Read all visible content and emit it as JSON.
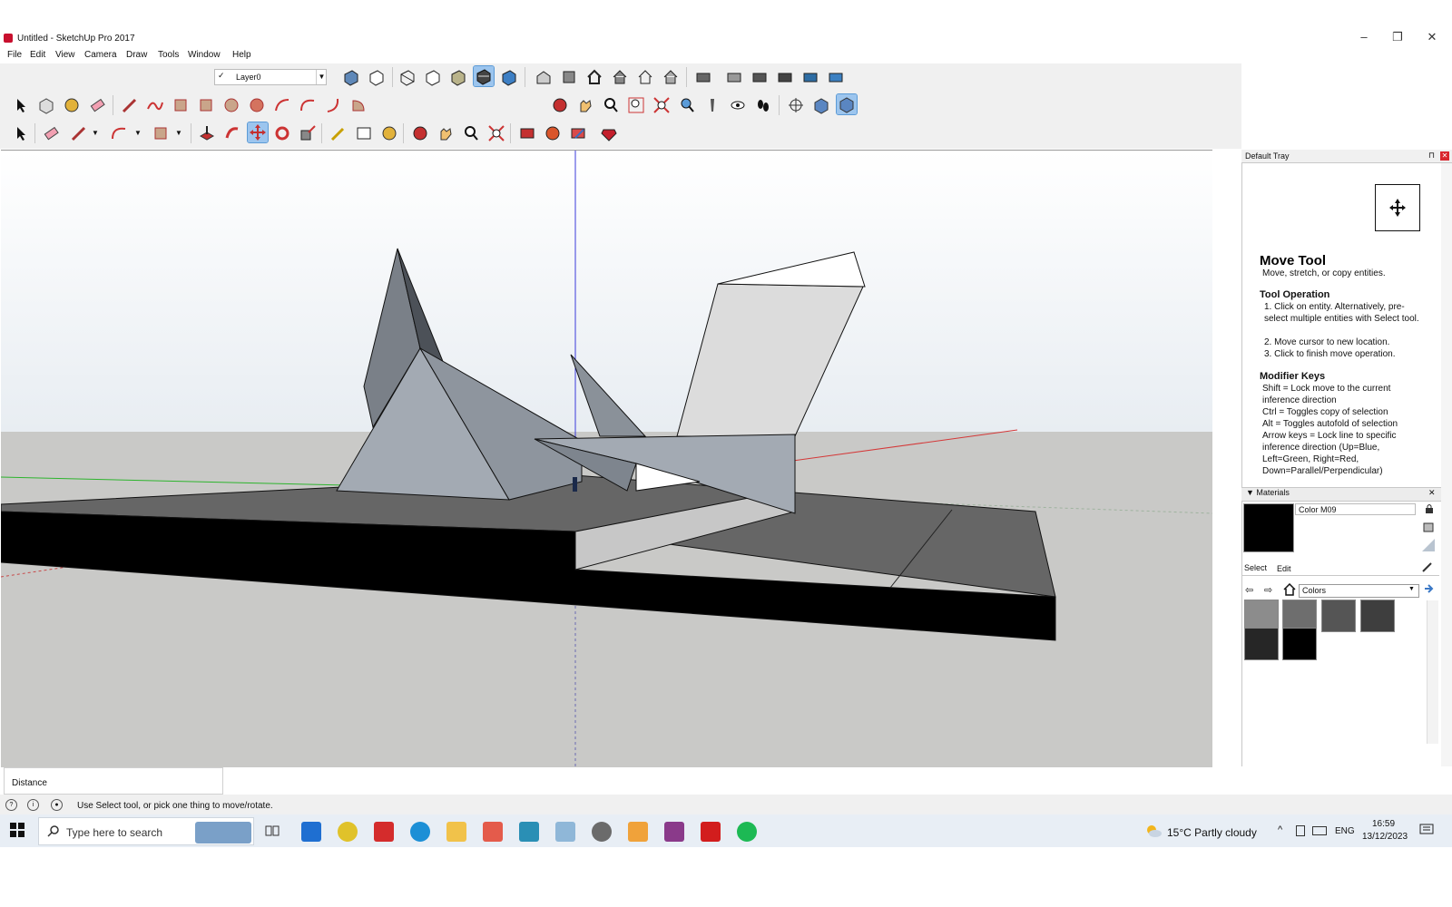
{
  "window": {
    "title": "Untitled - SketchUp Pro 2017",
    "minimize": "–",
    "restore": "❐",
    "close": "✕"
  },
  "menu": [
    "File",
    "Edit",
    "View",
    "Camera",
    "Draw",
    "Tools",
    "Window",
    "Help"
  ],
  "layer": {
    "check": "✓",
    "name": "Layer0",
    "dropdown": "▼"
  },
  "tray": {
    "title": "Default Tray",
    "pin": "⊓",
    "close": "✕",
    "instructor": {
      "tool_name": "Move Tool",
      "description": "Move, stretch, or copy entities.",
      "operation_heading": "Tool Operation",
      "operation_steps": [
        "Click on entity. Alternatively, pre-select multiple entities with Select tool.",
        "Move cursor to new location.",
        "Click to finish move operation."
      ],
      "modifier_heading": "Modifier Keys",
      "modifier_lines": [
        "Shift = Lock move to the current",
        "inference direction",
        "Ctrl = Toggles copy of selection",
        "Alt = Toggles autofold of selection",
        "Arrow keys = Lock line to specific",
        "inference direction (Up=Blue,",
        "Left=Green, Right=Red,",
        "Down=Parallel/Perpendicular)"
      ]
    },
    "materials": {
      "label": "Materials",
      "close": "✕",
      "current_name": "Color M09",
      "current_color": "#000000",
      "tab_select": "Select",
      "tab_edit": "Edit",
      "library": "Colors",
      "swatches": [
        "#8c8c8c",
        "#6e6e6e",
        "#555555",
        "#3e3e3e",
        "#262626",
        "#000000"
      ]
    }
  },
  "distance_label": "Distance",
  "status": {
    "text": "Use Select tool, or pick one thing to move/rotate."
  },
  "taskbar": {
    "search_placeholder": "Type here to search",
    "weather": "15°C  Partly cloudy",
    "language": "ENG",
    "time": "16:59",
    "date": "13/12/2023"
  }
}
